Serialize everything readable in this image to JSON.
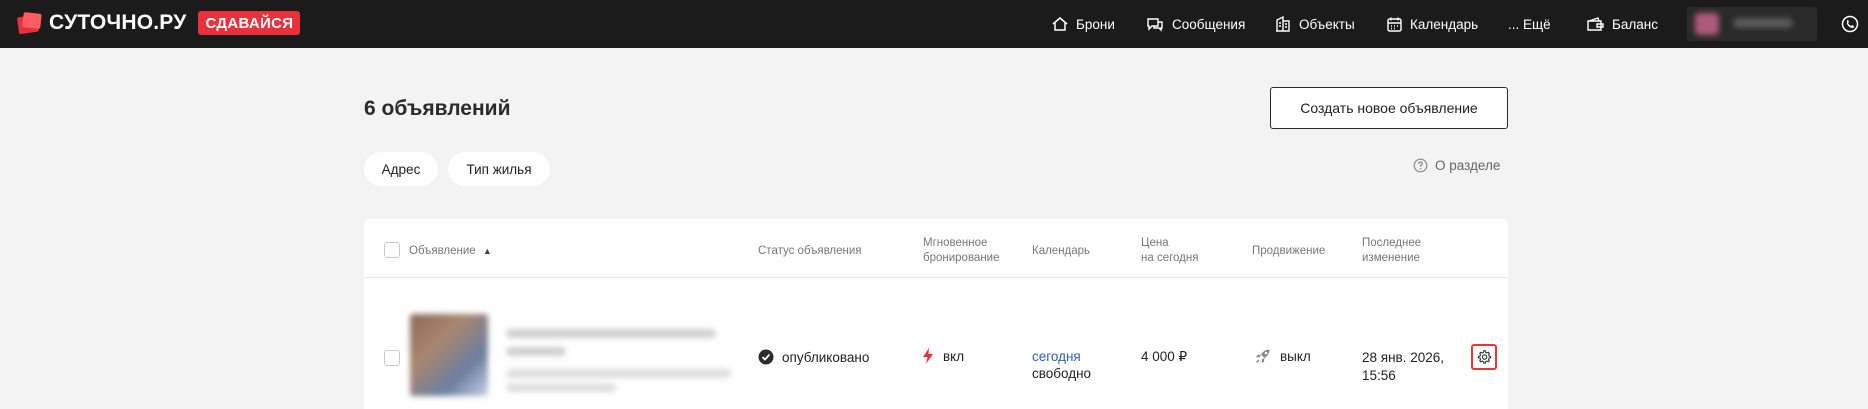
{
  "brand": {
    "name": "СУТОЧНО.РУ",
    "badge": "СДАВАЙСЯ"
  },
  "nav": {
    "bookings": "Брони",
    "messages": "Сообщения",
    "objects": "Объекты",
    "calendar": "Календарь",
    "more": "... Ещё",
    "balance": "Баланс"
  },
  "page": {
    "title": "6 объявлений",
    "create_button": "Создать новое объявление",
    "filters": [
      "Адрес",
      "Тип жилья"
    ],
    "about": "О разделе"
  },
  "table": {
    "headers": {
      "listing": "Объявление",
      "status": "Статус объявления",
      "instant_line1": "Мгновенное",
      "instant_line2": "бронирование",
      "calendar": "Календарь",
      "price_line1": "Цена",
      "price_line2": "на сегодня",
      "promotion": "Продвижение",
      "changed_line1": "Последнее",
      "changed_line2": "изменение"
    },
    "rows": [
      {
        "status": "опубликовано",
        "instant": "вкл",
        "calendar_link": "сегодня",
        "calendar_state": "свободно",
        "price": "4 000 ₽",
        "promotion": "выкл",
        "changed_line1": "28 янв. 2026,",
        "changed_line2": "15:56"
      }
    ]
  },
  "colors": {
    "brand_red": "#e8313a",
    "link_blue": "#2e62b5",
    "highlight_red": "#e53935",
    "topbar": "#1b1b1b"
  }
}
